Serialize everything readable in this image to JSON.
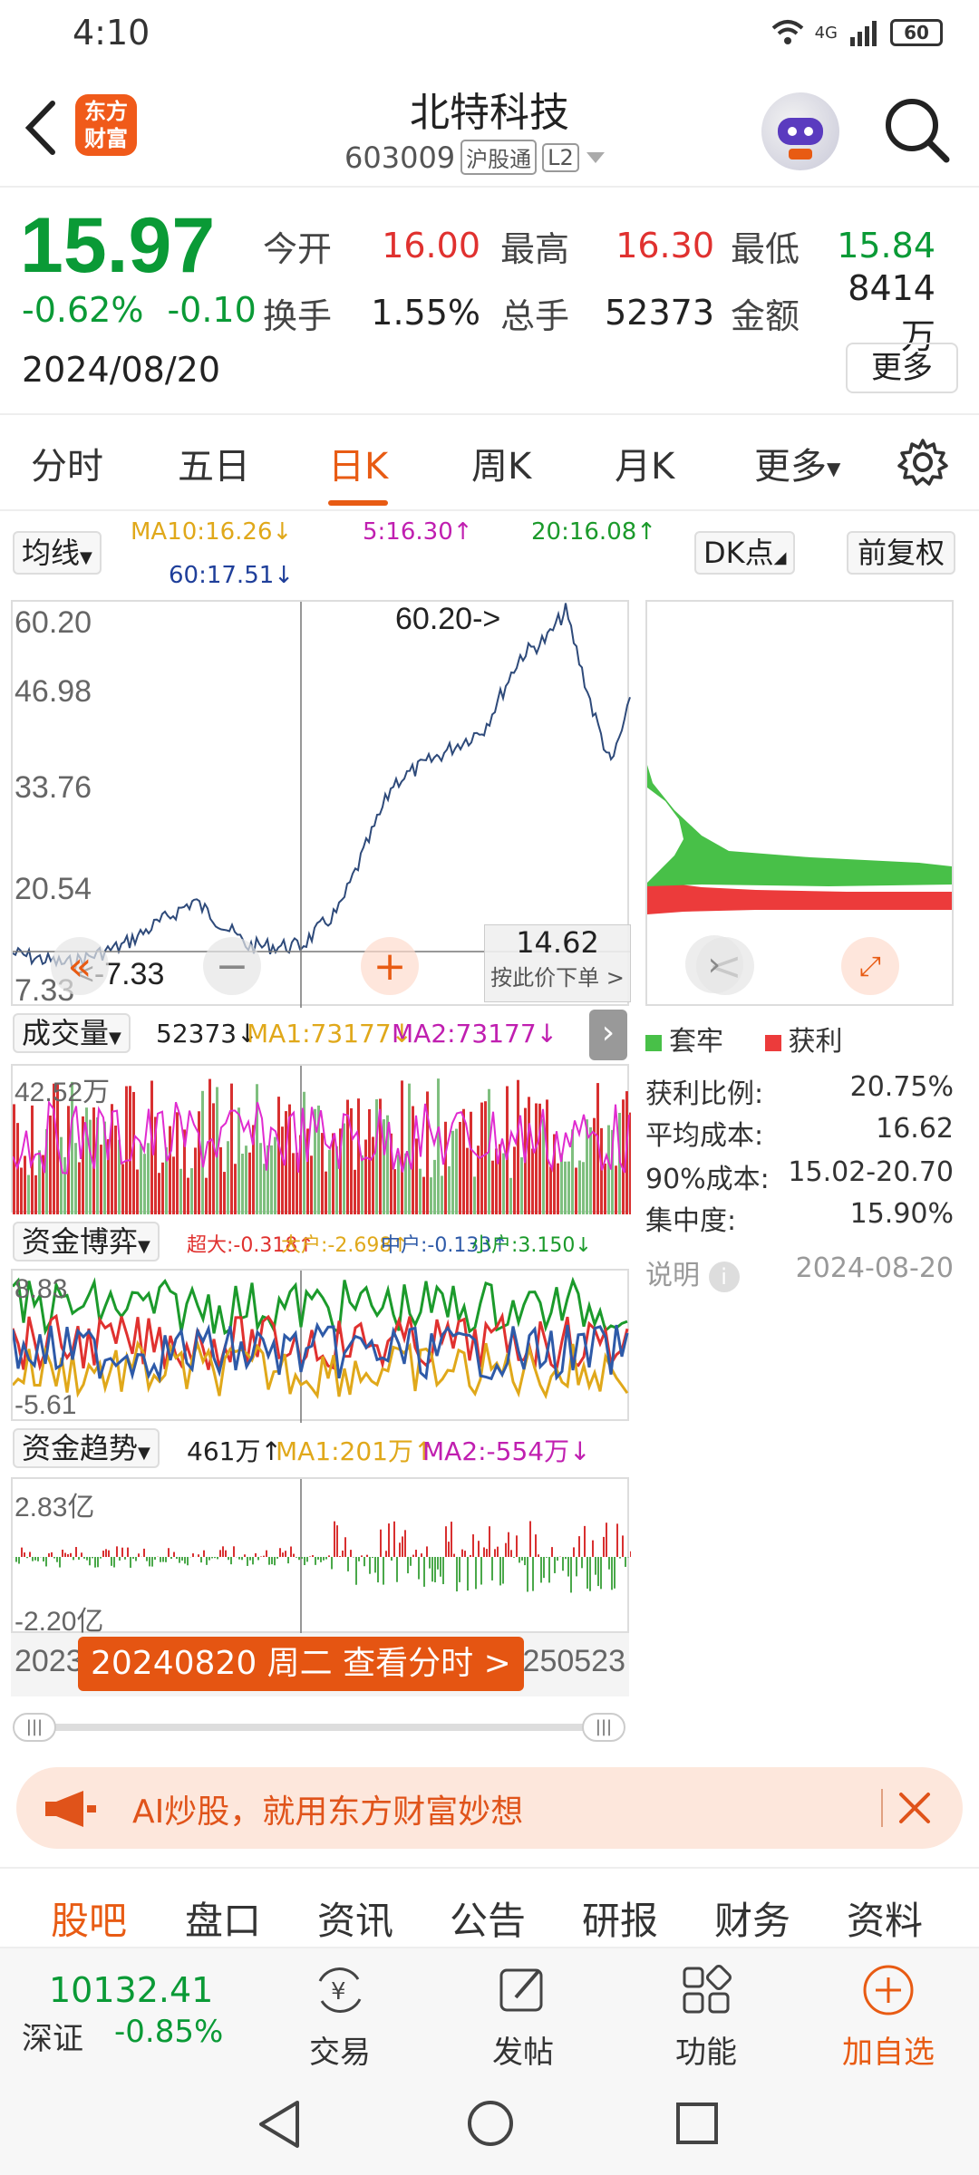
{
  "status": {
    "time": "4:10",
    "network": "4G",
    "battery": "60"
  },
  "header": {
    "logo_line1": "东方",
    "logo_line2": "财富",
    "name": "北特科技",
    "code": "603009",
    "tag1": "沪股通",
    "tag2": "L2"
  },
  "quote": {
    "price": "15.97",
    "pct": "-0.62%",
    "chg": "-0.10",
    "date": "2024/08/20",
    "open_label": "今开",
    "open": "16.00",
    "high_label": "最高",
    "high": "16.30",
    "low_label": "最低",
    "low": "15.84",
    "turnover_label": "换手",
    "turnover": "1.55%",
    "volume_label": "总手",
    "volume": "52373",
    "amount_label": "金额",
    "amount": "8414万",
    "more": "更多"
  },
  "tabs": [
    "分时",
    "五日",
    "日K",
    "周K",
    "月K",
    "更多"
  ],
  "ma": {
    "button": "均线",
    "ma10": "MA10:16.26↓",
    "ma5": "5:16.30↑",
    "ma20": "20:16.08↑",
    "ma60": "60:17.51↓",
    "dk": "DK点",
    "fq": "前复权"
  },
  "main_chart": {
    "y_labels": [
      "60.20",
      "46.98",
      "33.76",
      "20.54",
      "7.33"
    ],
    "max_label": "60.20->",
    "min_label": "<-7.33",
    "cursor_price": "14.62",
    "cursor_hint": "按此价下单 >"
  },
  "volume": {
    "button": "成交量",
    "v": "52373↓",
    "ma1": "MA1:73177↓",
    "ma2": "MA2:73177↓",
    "y_top": "42.52万"
  },
  "fund_game": {
    "button": "资金博弈",
    "super": "超大:-0.318↑",
    "big": "大户:-2.698↑",
    "mid": "中户:-0.133↑",
    "small": "小户:3.150↓",
    "y_top": "8.83",
    "y_bottom": "-5.61"
  },
  "fund_trend": {
    "button": "资金趋势",
    "v": "461万↑",
    "ma1": "MA1:201万↑",
    "ma2": "MA2:-554万↓",
    "y_top": "2.83亿",
    "y_bottom": "-2.20亿"
  },
  "axis_dates": {
    "left": "2023",
    "right": "250523"
  },
  "date_badge": "20240820 周二 查看分时 >",
  "chips": {
    "legend1": "套牢",
    "legend2": "获利",
    "rows": [
      {
        "label": "获利比例:",
        "value": "20.75%"
      },
      {
        "label": "平均成本:",
        "value": "16.62"
      },
      {
        "label": "90%成本:",
        "value": "15.02-20.70"
      },
      {
        "label": "集中度:",
        "value": "15.90%"
      }
    ],
    "note": "说明",
    "date": "2024-08-20"
  },
  "ad": {
    "text": "AI炒股，就用东方财富妙想"
  },
  "bottom_tabs": [
    "股吧",
    "盘口",
    "资讯",
    "公告",
    "研报",
    "财务",
    "资料"
  ],
  "bottom_bar": {
    "index_value": "10132.41",
    "index_name": "深证",
    "index_pct": "-0.85%",
    "trade": "交易",
    "post": "发帖",
    "func": "功能",
    "add": "加自选"
  },
  "colors": {
    "up": "#e0312f",
    "down": "#0a9a36",
    "accent": "#e85b13",
    "line": "#2e4a7a"
  }
}
